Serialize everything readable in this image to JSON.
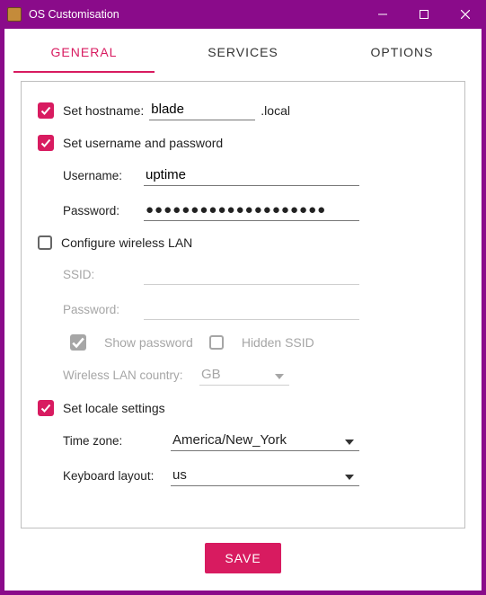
{
  "window": {
    "title": "OS Customisation"
  },
  "tabs": {
    "general": "GENERAL",
    "services": "SERVICES",
    "options": "OPTIONS"
  },
  "hostname": {
    "checkbox_label": "Set hostname:",
    "value": "blade",
    "suffix": ".local"
  },
  "userpass": {
    "checkbox_label": "Set username and password",
    "username_label": "Username:",
    "username_value": "uptime",
    "password_label": "Password:",
    "password_mask": "●●●●●●●●●●●●●●●●●●●●"
  },
  "wifi": {
    "checkbox_label": "Configure wireless LAN",
    "ssid_label": "SSID:",
    "ssid_value": "",
    "password_label": "Password:",
    "password_value": "",
    "showpw_label": "Show password",
    "hidden_label": "Hidden SSID",
    "country_label": "Wireless LAN country:",
    "country_value": "GB"
  },
  "locale": {
    "checkbox_label": "Set locale settings",
    "tz_label": "Time zone:",
    "tz_value": "America/New_York",
    "kb_label": "Keyboard layout:",
    "kb_value": "us"
  },
  "save_label": "SAVE"
}
